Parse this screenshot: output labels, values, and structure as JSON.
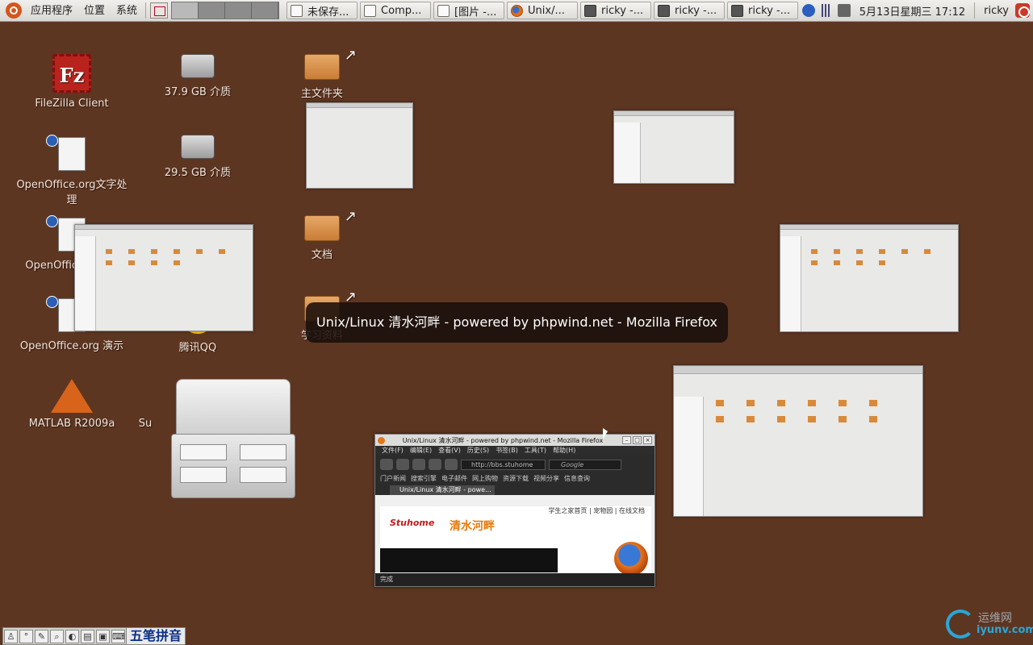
{
  "top_panel": {
    "menus": [
      "应用程序",
      "位置",
      "系统"
    ],
    "tasks": [
      {
        "icon": "document-icon",
        "label": "未保存..."
      },
      {
        "icon": "compiz-icon",
        "label": "Comp..."
      },
      {
        "icon": "image-icon",
        "label": "[图片 -..."
      },
      {
        "icon": "firefox-icon",
        "label": "Unix/..."
      },
      {
        "icon": "terminal-icon",
        "label": "ricky -..."
      },
      {
        "icon": "terminal-icon",
        "label": "ricky -..."
      },
      {
        "icon": "terminal-icon",
        "label": "ricky -..."
      }
    ],
    "clock": "5月13日星期三 17:12",
    "user": "ricky"
  },
  "desktop": {
    "icons": [
      {
        "name": "filezilla",
        "label": "FileZilla Client"
      },
      {
        "name": "drive-1",
        "label": "37.9 GB 介质"
      },
      {
        "name": "home-folder",
        "label": "主文件夹"
      },
      {
        "name": "oo-writer",
        "label": "OpenOffice.org文字处理"
      },
      {
        "name": "drive-2",
        "label": "29.5 GB 介质"
      },
      {
        "name": "oo-calc",
        "label": "OpenOffice.org 表"
      },
      {
        "name": "documents-folder",
        "label": "文档"
      },
      {
        "name": "oo-impress",
        "label": "OpenOffice.org 演示"
      },
      {
        "name": "qq",
        "label": "腾讯QQ"
      },
      {
        "name": "study-folder",
        "label": "学习资料"
      },
      {
        "name": "matlab",
        "label": "MATLAB R2009a"
      },
      {
        "name": "su-partial",
        "label": "Su"
      }
    ]
  },
  "switcher": {
    "title": "Unix/Linux 清水河畔 - powered by phpwind.net - Mozilla Firefox"
  },
  "firefox_preview": {
    "title": "Unix/Linux 清水河畔 - powered by phpwind.net - Mozilla Firefox",
    "menus": [
      "文件(F)",
      "编辑(E)",
      "查看(V)",
      "历史(S)",
      "书签(B)",
      "工具(T)",
      "帮助(H)"
    ],
    "url": "http://bbs.stuhome",
    "search": "Google",
    "bookmarks": [
      "门户新闻",
      "搜索引擎",
      "电子邮件",
      "网上购物",
      "资源下载",
      "视频分享",
      "信息查询"
    ],
    "tab": "Unix/Linux 清水河畔 - powe...",
    "top_links": "学生之家首页 | 宠物园 | 在线文档",
    "logo_text": "Stuhome",
    "logo_cn": "清水河畔",
    "status": "完成"
  },
  "ime": {
    "name": "五笔拼音"
  },
  "watermark": {
    "cn": "运维网",
    "en": "iyunv.com"
  }
}
